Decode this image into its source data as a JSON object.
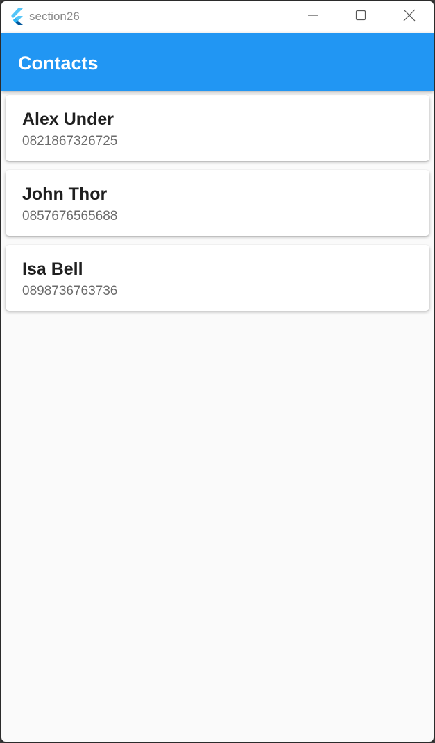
{
  "window": {
    "title": "section26"
  },
  "appbar": {
    "title": "Contacts",
    "color": "#2196f3"
  },
  "contacts": [
    {
      "name": "Alex Under",
      "phone": "0821867326725"
    },
    {
      "name": "John Thor",
      "phone": "0857676565688"
    },
    {
      "name": "Isa Bell",
      "phone": "0898736763736"
    }
  ],
  "icons": {
    "logo": "flutter-logo-icon",
    "minimize": "minimize-icon",
    "maximize": "maximize-icon",
    "close": "close-icon"
  }
}
